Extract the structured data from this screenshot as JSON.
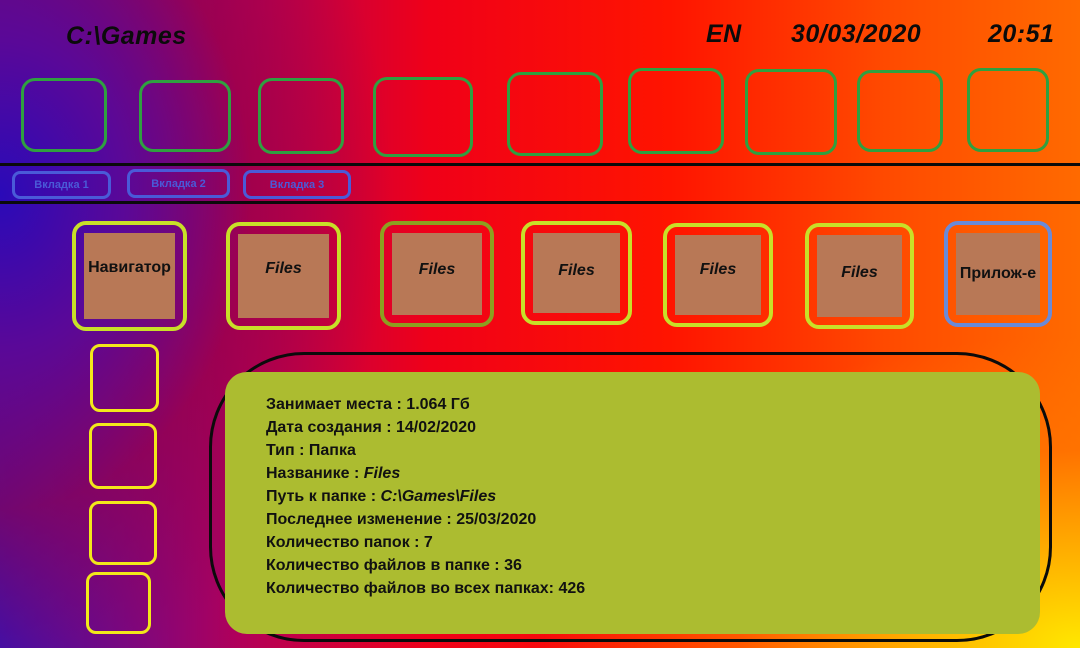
{
  "header": {
    "path": "C:\\Games",
    "language": "EN",
    "date": "30/03/2020",
    "time": "20:51"
  },
  "tabs": [
    {
      "label": "Вкладка 1"
    },
    {
      "label": "Вкладка 2"
    },
    {
      "label": "Вкладка 3"
    }
  ],
  "folders": [
    {
      "label": "Навигатор"
    },
    {
      "label": "Files"
    },
    {
      "label": "Files"
    },
    {
      "label": "Files"
    },
    {
      "label": "Files"
    },
    {
      "label": "Files"
    },
    {
      "label": "Прилож-е"
    }
  ],
  "info": {
    "size_label": "Занимает места : ",
    "size_value": "1.064 Гб",
    "created_label": "Дата создания : ",
    "created_value": "14/02/2020",
    "type_label": "Тип : ",
    "type_value": "Папка",
    "name_label": "Названике : ",
    "name_value": "Files",
    "path_label": "Путь к папке : ",
    "path_value": "C:\\Games\\Files",
    "modified_label": "Последнее изменение : ",
    "modified_value": "25/03/2020",
    "folders_count_label": "Количество папок : ",
    "folders_count_value": "7",
    "files_count_label": "Количество файлов в папке : ",
    "files_count_value": "36",
    "all_files_label": "Количество файлов во всех папках: ",
    "all_files_value": "426"
  },
  "colors": {
    "app_slot_border": "#2fa040",
    "tab_border": "#4a5ad8",
    "folder_fill": "#b87856",
    "side_slot_border": "#f2e81a",
    "info_fill": "#acbc30"
  }
}
